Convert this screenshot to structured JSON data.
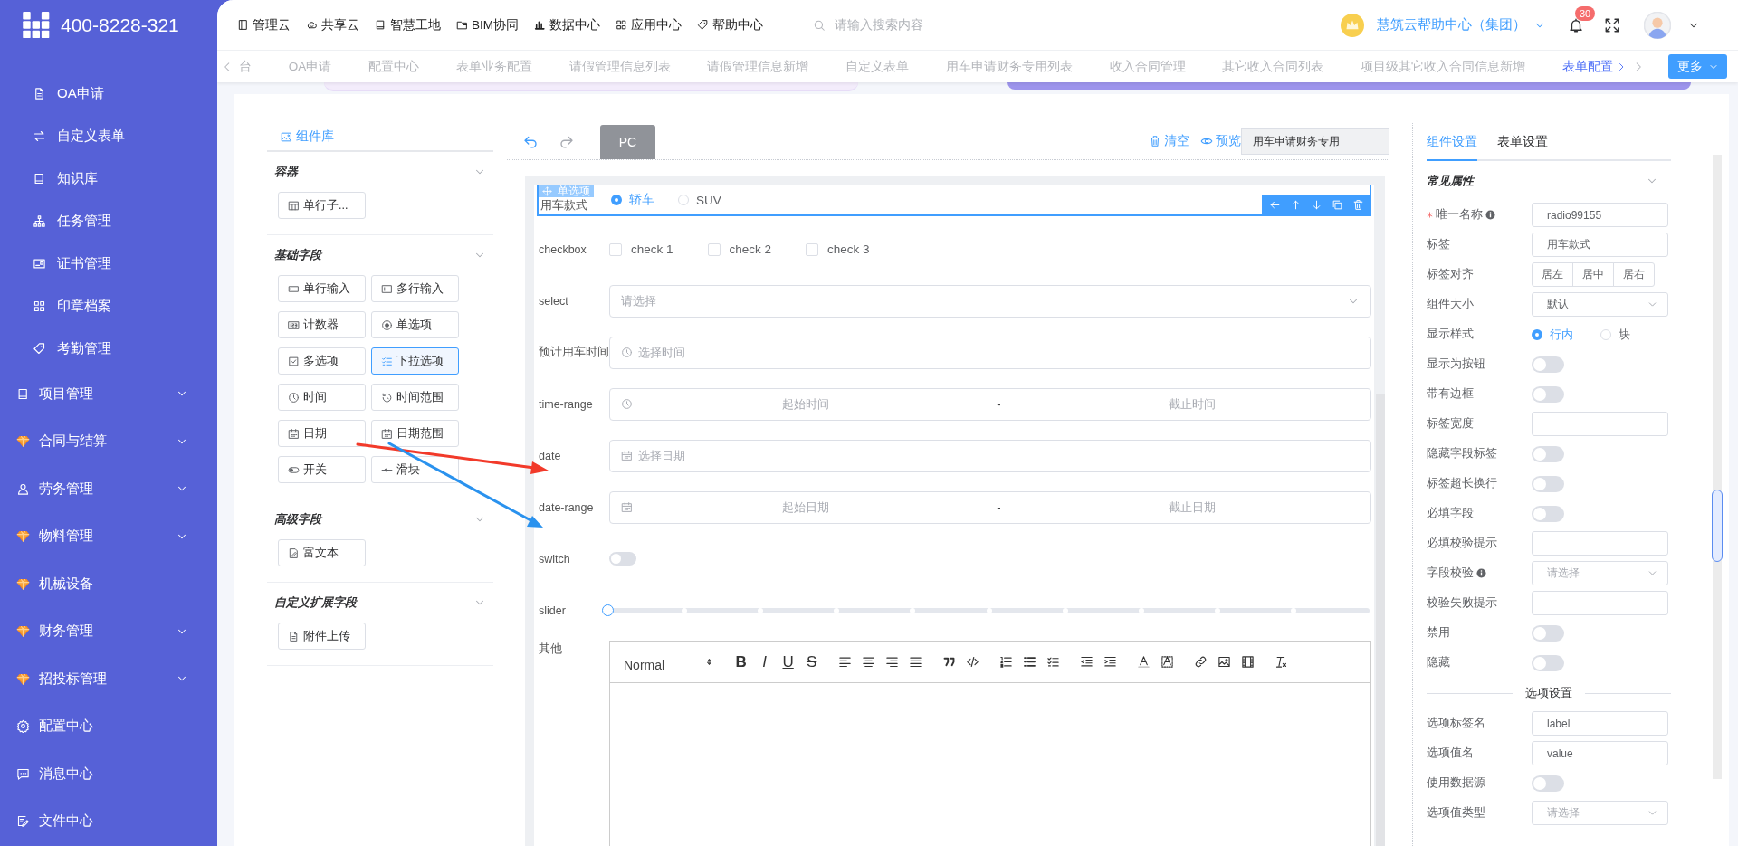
{
  "brand": {
    "phone": "400-8228-321"
  },
  "sidebar": [
    {
      "label": "OA申请",
      "kind": "sub"
    },
    {
      "label": "自定义表单",
      "kind": "sub"
    },
    {
      "label": "知识库",
      "kind": "sub"
    },
    {
      "label": "任务管理",
      "kind": "sub"
    },
    {
      "label": "证书管理",
      "kind": "sub"
    },
    {
      "label": "印章档案",
      "kind": "sub"
    },
    {
      "label": "考勤管理",
      "kind": "sub"
    },
    {
      "label": "项目管理",
      "kind": "group",
      "expanded": false
    },
    {
      "label": "合同与结算",
      "kind": "group",
      "expanded": false
    },
    {
      "label": "劳务管理",
      "kind": "group",
      "expanded": false
    },
    {
      "label": "物料管理",
      "kind": "group",
      "expanded": false
    },
    {
      "label": "机械设备",
      "kind": "link"
    },
    {
      "label": "财务管理",
      "kind": "group",
      "expanded": false
    },
    {
      "label": "招投标管理",
      "kind": "group",
      "expanded": false
    },
    {
      "label": "配置中心",
      "kind": "link"
    },
    {
      "label": "消息中心",
      "kind": "link"
    },
    {
      "label": "文件中心",
      "kind": "link"
    }
  ],
  "header": {
    "nav": [
      "管理云",
      "共享云",
      "智慧工地",
      "BIM协同",
      "数据中心",
      "应用中心",
      "帮助中心"
    ],
    "search": {
      "placeholder": "请输入搜索内容"
    },
    "org": "慧筑云帮助中心（集团）",
    "notifications": "30"
  },
  "tabs": [
    {
      "label": "台",
      "selected": false
    },
    {
      "label": "OA申请",
      "selected": false
    },
    {
      "label": "配置中心",
      "selected": false
    },
    {
      "label": "表单业务配置",
      "selected": false
    },
    {
      "label": "请假管理信息列表",
      "selected": false
    },
    {
      "label": "请假管理信息新增",
      "selected": false
    },
    {
      "label": "自定义表单",
      "selected": false
    },
    {
      "label": "用车申请财务专用列表",
      "selected": false
    },
    {
      "label": "收入合同管理",
      "selected": false
    },
    {
      "label": "其它收入合同列表",
      "selected": false
    },
    {
      "label": "项目级其它收入合同信息新增",
      "selected": false
    },
    {
      "label": "表单配置",
      "selected": true
    }
  ],
  "more_button": "更多",
  "library": {
    "title": "组件库",
    "groups": [
      {
        "title": "容器",
        "expanded": true,
        "items": [
          {
            "label": "单行子...",
            "selected": false
          }
        ]
      },
      {
        "title": "基础字段",
        "expanded": true,
        "items": [
          {
            "label": "单行输入",
            "selected": false
          },
          {
            "label": "多行输入",
            "selected": false
          },
          {
            "label": "计数器",
            "selected": false
          },
          {
            "label": "单选项",
            "selected": false
          },
          {
            "label": "多选项",
            "selected": false
          },
          {
            "label": "下拉选项",
            "selected": true
          },
          {
            "label": "时间",
            "selected": false
          },
          {
            "label": "时间范围",
            "selected": false
          },
          {
            "label": "日期",
            "selected": false
          },
          {
            "label": "日期范围",
            "selected": false
          },
          {
            "label": "开关",
            "selected": false
          },
          {
            "label": "滑块",
            "selected": false
          }
        ]
      },
      {
        "title": "高级字段",
        "expanded": true,
        "items": [
          {
            "label": "富文本",
            "selected": false
          }
        ]
      },
      {
        "title": "自定义扩展字段",
        "expanded": true,
        "items": [
          {
            "label": "附件上传",
            "selected": false
          }
        ]
      }
    ]
  },
  "toolbar": {
    "device": "PC",
    "clear": "清空",
    "preview": "预览",
    "form_name": "用车申请财务专用"
  },
  "fields": [
    {
      "kind": "radio",
      "label": "用车款式",
      "selected": true,
      "tag": "单选项",
      "options": [
        {
          "label": "轿车",
          "selected": true
        },
        {
          "label": "SUV",
          "selected": false
        }
      ]
    },
    {
      "kind": "checkbox",
      "label": "checkbox",
      "selected": false,
      "options": [
        {
          "label": "check 1",
          "checked": false
        },
        {
          "label": "check 2",
          "checked": false
        },
        {
          "label": "check 3",
          "checked": false
        }
      ]
    },
    {
      "kind": "select",
      "label": "select",
      "selected": false,
      "placeholder": "请选择"
    },
    {
      "kind": "time",
      "label": "预计用车时间",
      "selected": false,
      "placeholder": "选择时间"
    },
    {
      "kind": "time-range",
      "label": "time-range",
      "selected": false,
      "start": "起始时间",
      "separator": "-",
      "end": "截止时间"
    },
    {
      "kind": "date",
      "label": "date",
      "selected": false,
      "placeholder": "选择日期"
    },
    {
      "kind": "date-range",
      "label": "date-range",
      "selected": false,
      "start": "起始日期",
      "separator": "-",
      "end": "截止日期"
    },
    {
      "kind": "switch",
      "label": "switch",
      "selected": false,
      "on": false
    },
    {
      "kind": "slider",
      "label": "slider",
      "selected": false,
      "level": 0
    },
    {
      "kind": "editor",
      "label": "其他",
      "selected": false,
      "heading": "Normal",
      "format_buttons": [
        "B",
        "I",
        "U",
        "S"
      ]
    }
  ],
  "settings": {
    "tabs": [
      {
        "label": "组件设置",
        "selected": true
      },
      {
        "label": "表单设置",
        "selected": false
      }
    ],
    "section": {
      "title": "常见属性",
      "expanded": true
    },
    "props": [
      {
        "label": "唯一名称",
        "kind": "input",
        "value": "radio99155",
        "required": true,
        "info": true
      },
      {
        "label": "标签",
        "kind": "input",
        "value": "用车款式",
        "required": false,
        "info": false
      },
      {
        "label": "标签对齐",
        "kind": "segmented",
        "required": false,
        "info": false,
        "options": [
          {
            "label": "居左",
            "selected": false
          },
          {
            "label": "居中",
            "selected": false
          },
          {
            "label": "居右",
            "selected": false
          }
        ]
      },
      {
        "label": "组件大小",
        "kind": "select",
        "value": "默认",
        "required": false,
        "info": false
      },
      {
        "label": "显示样式",
        "kind": "radio",
        "required": false,
        "info": false,
        "options": [
          {
            "label": "行内",
            "selected": true
          },
          {
            "label": "块",
            "selected": false
          }
        ]
      },
      {
        "label": "显示为按钮",
        "kind": "switch",
        "on": false,
        "required": false,
        "info": false
      },
      {
        "label": "带有边框",
        "kind": "switch",
        "on": false,
        "required": false,
        "info": false
      },
      {
        "label": "标签宽度",
        "kind": "input",
        "required": false,
        "info": false
      },
      {
        "label": "隐藏字段标签",
        "kind": "switch",
        "on": false,
        "required": false,
        "info": false
      },
      {
        "label": "标签超长换行",
        "kind": "switch",
        "on": false,
        "required": false,
        "info": false
      },
      {
        "label": "必填字段",
        "kind": "switch",
        "on": false,
        "required": false,
        "info": false
      },
      {
        "label": "必填校验提示",
        "kind": "input",
        "required": false,
        "info": false
      },
      {
        "label": "字段校验",
        "kind": "select",
        "placeholder": "请选择",
        "required": false,
        "info": true
      },
      {
        "label": "校验失败提示",
        "kind": "input",
        "required": false,
        "info": false
      },
      {
        "label": "禁用",
        "kind": "switch",
        "on": false,
        "required": false,
        "info": false
      },
      {
        "label": "隐藏",
        "kind": "switch",
        "on": false,
        "required": false,
        "info": false
      }
    ],
    "options_title": "选项设置",
    "option_props": [
      {
        "label": "选项标签名",
        "kind": "input",
        "value": "label"
      },
      {
        "label": "选项值名",
        "kind": "input",
        "value": "value"
      },
      {
        "label": "使用数据源",
        "kind": "switch",
        "on": false
      },
      {
        "label": "选项值类型",
        "kind": "select",
        "placeholder": "请选择"
      }
    ]
  }
}
